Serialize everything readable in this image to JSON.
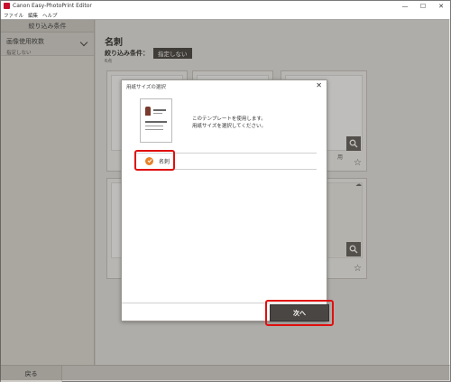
{
  "window": {
    "title": "Canon Easy-PhotoPrint Editor",
    "minimize": "—",
    "maximize": "☐",
    "close": "✕"
  },
  "menu": [
    "ファイル",
    "編集",
    "ヘルプ"
  ],
  "sidebar": {
    "heading": "絞り込み条件",
    "filter_title": "画像使用枚数",
    "filter_value": "指定しない"
  },
  "main": {
    "title": "名刺",
    "filter_label": "絞り込み条件：",
    "filter_chip": "指定しない",
    "count": "6点",
    "card_partial_text": "用"
  },
  "dialog": {
    "title": "用紙サイズの選択",
    "close": "✕",
    "description_line1": "このテンプレートを使用します。",
    "description_line2": "用紙サイズを選択してください。",
    "paper_option": "名刺",
    "next_button": "次へ"
  },
  "bottom": {
    "back_button": "戻る"
  },
  "colors": {
    "accent_orange": "#e8822a",
    "highlight_red": "#e01010",
    "dark_button": "#4a4643"
  },
  "icons": {
    "zoom": "magnifier-icon",
    "favorite": "star-icon",
    "download": "cloud-download-icon",
    "check": "check-icon"
  }
}
